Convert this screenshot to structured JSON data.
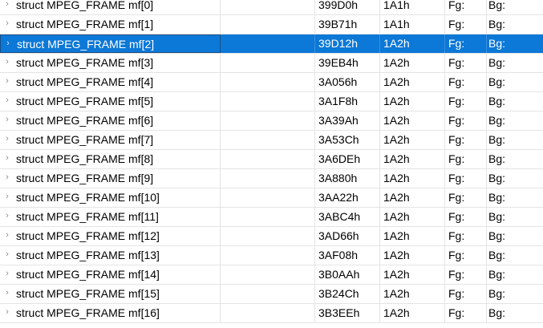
{
  "template_tree": {
    "rows": [
      {
        "name": "struct MPEG_FRAME mf[0]",
        "start": "399D0h",
        "size": "1A1h",
        "fg": "Fg:",
        "bg": "Bg:",
        "selected": false,
        "expander": "›"
      },
      {
        "name": "struct MPEG_FRAME mf[1]",
        "start": "39B71h",
        "size": "1A1h",
        "fg": "Fg:",
        "bg": "Bg:",
        "selected": false,
        "expander": "›"
      },
      {
        "name": "struct MPEG_FRAME mf[2]",
        "start": "39D12h",
        "size": "1A2h",
        "fg": "Fg:",
        "bg": "Bg:",
        "selected": true,
        "expander": "›"
      },
      {
        "name": "struct MPEG_FRAME mf[3]",
        "start": "39EB4h",
        "size": "1A2h",
        "fg": "Fg:",
        "bg": "Bg:",
        "selected": false,
        "expander": "›"
      },
      {
        "name": "struct MPEG_FRAME mf[4]",
        "start": "3A056h",
        "size": "1A2h",
        "fg": "Fg:",
        "bg": "Bg:",
        "selected": false,
        "expander": "›"
      },
      {
        "name": "struct MPEG_FRAME mf[5]",
        "start": "3A1F8h",
        "size": "1A2h",
        "fg": "Fg:",
        "bg": "Bg:",
        "selected": false,
        "expander": "›"
      },
      {
        "name": "struct MPEG_FRAME mf[6]",
        "start": "3A39Ah",
        "size": "1A2h",
        "fg": "Fg:",
        "bg": "Bg:",
        "selected": false,
        "expander": "›"
      },
      {
        "name": "struct MPEG_FRAME mf[7]",
        "start": "3A53Ch",
        "size": "1A2h",
        "fg": "Fg:",
        "bg": "Bg:",
        "selected": false,
        "expander": "›"
      },
      {
        "name": "struct MPEG_FRAME mf[8]",
        "start": "3A6DEh",
        "size": "1A2h",
        "fg": "Fg:",
        "bg": "Bg:",
        "selected": false,
        "expander": "›"
      },
      {
        "name": "struct MPEG_FRAME mf[9]",
        "start": "3A880h",
        "size": "1A2h",
        "fg": "Fg:",
        "bg": "Bg:",
        "selected": false,
        "expander": "›"
      },
      {
        "name": "struct MPEG_FRAME mf[10]",
        "start": "3AA22h",
        "size": "1A2h",
        "fg": "Fg:",
        "bg": "Bg:",
        "selected": false,
        "expander": "›"
      },
      {
        "name": "struct MPEG_FRAME mf[11]",
        "start": "3ABC4h",
        "size": "1A2h",
        "fg": "Fg:",
        "bg": "Bg:",
        "selected": false,
        "expander": "›"
      },
      {
        "name": "struct MPEG_FRAME mf[12]",
        "start": "3AD66h",
        "size": "1A2h",
        "fg": "Fg:",
        "bg": "Bg:",
        "selected": false,
        "expander": "›"
      },
      {
        "name": "struct MPEG_FRAME mf[13]",
        "start": "3AF08h",
        "size": "1A2h",
        "fg": "Fg:",
        "bg": "Bg:",
        "selected": false,
        "expander": "›"
      },
      {
        "name": "struct MPEG_FRAME mf[14]",
        "start": "3B0AAh",
        "size": "1A2h",
        "fg": "Fg:",
        "bg": "Bg:",
        "selected": false,
        "expander": "›"
      },
      {
        "name": "struct MPEG_FRAME mf[15]",
        "start": "3B24Ch",
        "size": "1A2h",
        "fg": "Fg:",
        "bg": "Bg:",
        "selected": false,
        "expander": "›"
      },
      {
        "name": "struct MPEG_FRAME mf[16]",
        "start": "3B3EEh",
        "size": "1A2h",
        "fg": "Fg:",
        "bg": "Bg:",
        "selected": false,
        "expander": "›"
      }
    ]
  },
  "colors": {
    "selection_background": "#0c78d7",
    "selection_text": "#ffffff",
    "grid_line": "#e4e4e4",
    "expander_arrow": "#8a8a8a"
  }
}
